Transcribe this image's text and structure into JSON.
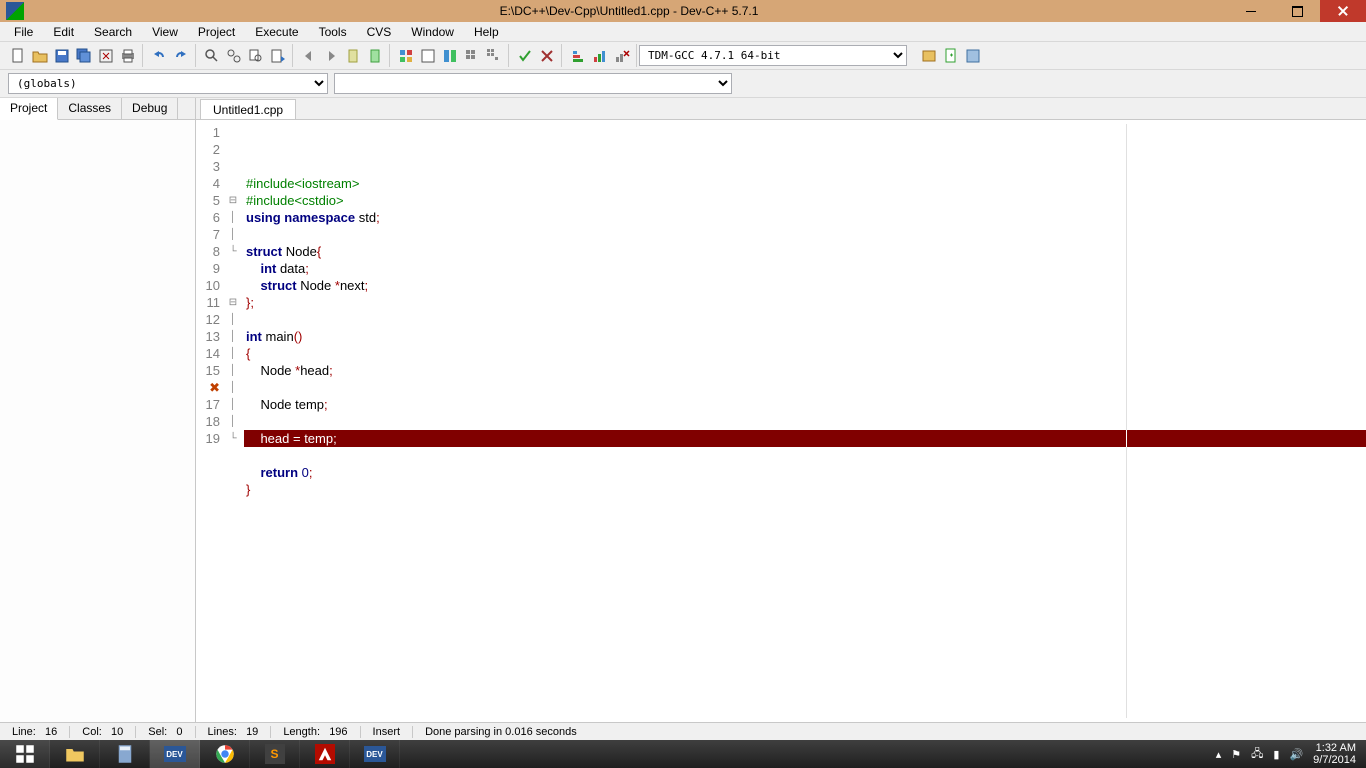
{
  "title": "E:\\DC++\\Dev-Cpp\\Untitled1.cpp - Dev-C++ 5.7.1",
  "menus": [
    "File",
    "Edit",
    "Search",
    "View",
    "Project",
    "Execute",
    "Tools",
    "CVS",
    "Window",
    "Help"
  ],
  "compiler_selector": "TDM-GCC 4.7.1 64-bit",
  "scope_selector": "(globals)",
  "side_tabs": [
    "Project",
    "Classes",
    "Debug"
  ],
  "active_side_tab": "Project",
  "file_tab": "Untitled1.cpp",
  "code": {
    "lines": [
      {
        "n": 1,
        "fold": "",
        "segs": [
          {
            "t": "#include<iostream>",
            "c": "kw-green"
          }
        ]
      },
      {
        "n": 2,
        "fold": "",
        "segs": [
          {
            "t": "#include<cstdio>",
            "c": "kw-green"
          }
        ]
      },
      {
        "n": 3,
        "fold": "",
        "segs": [
          {
            "t": "using namespace ",
            "c": "kw-blue"
          },
          {
            "t": "std",
            "c": "plain"
          },
          {
            "t": ";",
            "c": "kw-red"
          }
        ]
      },
      {
        "n": 4,
        "fold": "",
        "segs": [
          {
            "t": "",
            "c": "plain"
          }
        ]
      },
      {
        "n": 5,
        "fold": "⊟",
        "segs": [
          {
            "t": "struct ",
            "c": "kw-blue"
          },
          {
            "t": "Node",
            "c": "plain"
          },
          {
            "t": "{",
            "c": "kw-red"
          }
        ]
      },
      {
        "n": 6,
        "fold": "│",
        "segs": [
          {
            "t": "    ",
            "c": "plain"
          },
          {
            "t": "int ",
            "c": "kw-blue"
          },
          {
            "t": "data",
            "c": "plain"
          },
          {
            "t": ";",
            "c": "kw-red"
          }
        ]
      },
      {
        "n": 7,
        "fold": "│",
        "segs": [
          {
            "t": "    ",
            "c": "plain"
          },
          {
            "t": "struct ",
            "c": "kw-blue"
          },
          {
            "t": "Node ",
            "c": "plain"
          },
          {
            "t": "*",
            "c": "kw-red"
          },
          {
            "t": "next",
            "c": "plain"
          },
          {
            "t": ";",
            "c": "kw-red"
          }
        ]
      },
      {
        "n": 8,
        "fold": "└",
        "segs": [
          {
            "t": "};",
            "c": "kw-red"
          }
        ]
      },
      {
        "n": 9,
        "fold": "",
        "segs": [
          {
            "t": "",
            "c": "plain"
          }
        ]
      },
      {
        "n": 10,
        "fold": "",
        "segs": [
          {
            "t": "int ",
            "c": "kw-blue"
          },
          {
            "t": "main",
            "c": "plain"
          },
          {
            "t": "()",
            "c": "kw-red"
          }
        ]
      },
      {
        "n": 11,
        "fold": "⊟",
        "segs": [
          {
            "t": "{",
            "c": "kw-red"
          }
        ]
      },
      {
        "n": 12,
        "fold": "│",
        "segs": [
          {
            "t": "    Node ",
            "c": "plain"
          },
          {
            "t": "*",
            "c": "kw-red"
          },
          {
            "t": "head",
            "c": "plain"
          },
          {
            "t": ";",
            "c": "kw-red"
          }
        ]
      },
      {
        "n": 13,
        "fold": "│",
        "segs": [
          {
            "t": "",
            "c": "plain"
          }
        ]
      },
      {
        "n": 14,
        "fold": "│",
        "segs": [
          {
            "t": "    Node temp",
            "c": "plain"
          },
          {
            "t": ";",
            "c": "kw-red"
          }
        ]
      },
      {
        "n": 15,
        "fold": "│",
        "segs": [
          {
            "t": "",
            "c": "plain"
          }
        ]
      },
      {
        "n": 16,
        "fold": "│",
        "err": true,
        "segs": [
          {
            "t": "    head ",
            "c": ""
          },
          {
            "t": "=",
            "c": ""
          },
          {
            "t": " temp",
            "c": ""
          },
          {
            "t": ";",
            "c": ""
          }
        ]
      },
      {
        "n": 17,
        "fold": "│",
        "segs": [
          {
            "t": "",
            "c": "plain"
          }
        ]
      },
      {
        "n": 18,
        "fold": "│",
        "segs": [
          {
            "t": "    ",
            "c": "plain"
          },
          {
            "t": "return ",
            "c": "kw-blue"
          },
          {
            "t": "0",
            "c": "num"
          },
          {
            "t": ";",
            "c": "kw-red"
          }
        ]
      },
      {
        "n": 19,
        "fold": "└",
        "segs": [
          {
            "t": "}",
            "c": "kw-red"
          }
        ]
      }
    ],
    "error_line_gutter": "✖"
  },
  "status": {
    "line_label": "Line:",
    "line": "16",
    "col_label": "Col:",
    "col": "10",
    "sel_label": "Sel:",
    "sel": "0",
    "lines_label": "Lines:",
    "lines": "19",
    "length_label": "Length:",
    "length": "196",
    "mode": "Insert",
    "msg": "Done parsing in 0.016 seconds"
  },
  "tray": {
    "time": "1:32 AM",
    "date": "9/7/2014"
  }
}
